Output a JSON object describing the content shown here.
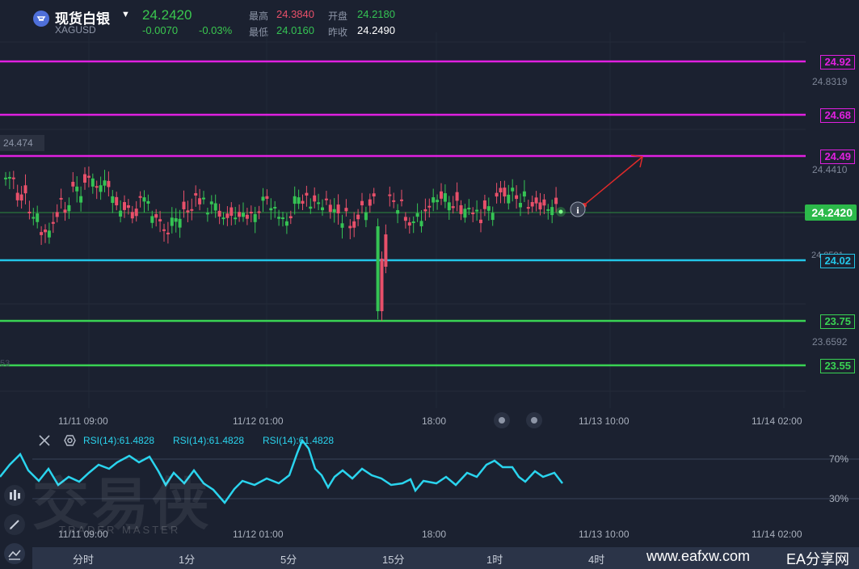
{
  "header": {
    "name": "现货白银",
    "code": "XAGUSD",
    "price": "24.2420",
    "change": "-0.0070",
    "change_pct": "-0.03%",
    "high_label": "最高",
    "high": "24.3840",
    "open_label": "开盘",
    "open": "24.2180",
    "low_label": "最低",
    "low": "24.0160",
    "prev_label": "昨收",
    "prev": "24.2490"
  },
  "price_axis": {
    "ticks": [
      "24.8319",
      "24.4410",
      "23.6592"
    ],
    "partial_ticks": [
      "24.474",
      "24.0501",
      "53"
    ]
  },
  "levels": [
    {
      "value": "24.92",
      "color": "#e020e0"
    },
    {
      "value": "24.68",
      "color": "#e020e0"
    },
    {
      "value": "24.49",
      "color": "#e020e0"
    },
    {
      "value": "24.02",
      "color": "#23c6e8"
    },
    {
      "value": "23.75",
      "color": "#39d353"
    },
    {
      "value": "23.55",
      "color": "#39d353"
    }
  ],
  "current_tag": "24.2420",
  "time_axis": [
    "11/11 09:00",
    "11/12 01:00",
    "18:00",
    "11/13 10:00",
    "11/14 02:00"
  ],
  "rsi": {
    "labels": [
      "RSI(14):61.4828",
      "RSI(14):61.4828",
      "RSI(14):61.4828"
    ],
    "levels": [
      "70%",
      "30%"
    ],
    "color": "#2ad4ee"
  },
  "watermark": {
    "text": "交易侠",
    "sub": "TRADER MASTER",
    "url": "www.eafxw.com",
    "brand": "EA分享网"
  },
  "tabs": [
    "分时",
    "1分",
    "5分",
    "15分",
    "1时",
    "4时"
  ],
  "colors": {
    "up": "#e8506a",
    "down": "#35c354",
    "bg": "#1b2130"
  }
}
